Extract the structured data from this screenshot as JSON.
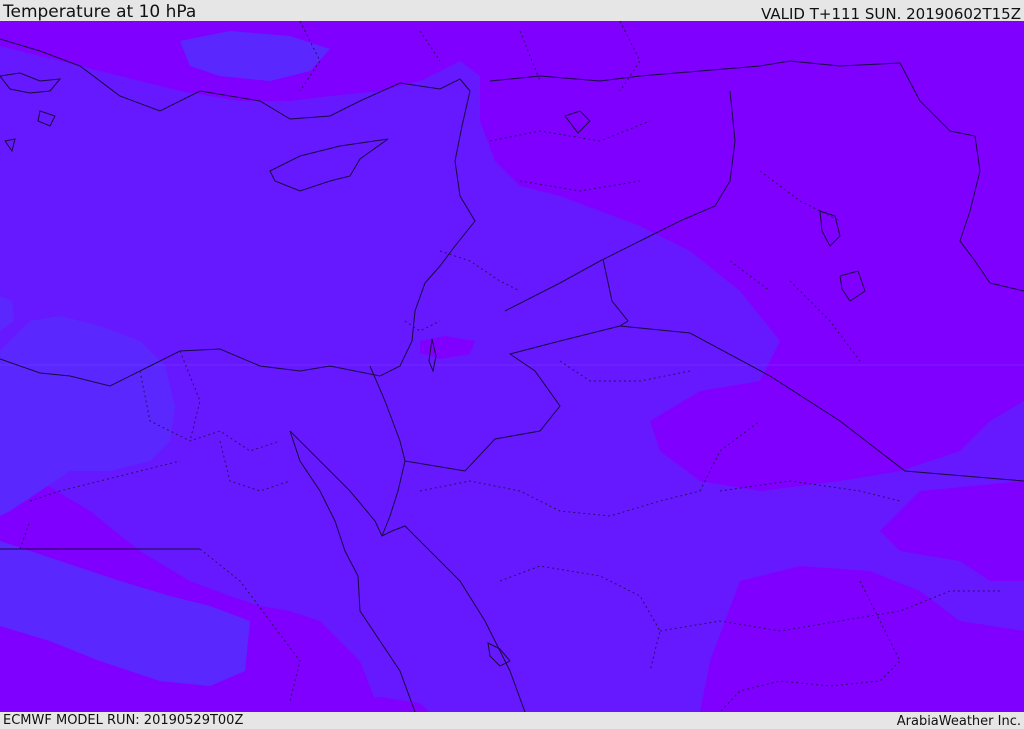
{
  "header": {
    "title": "Temperature at 10 hPa",
    "valid": "VALID T+111 SUN. 20190602T15Z"
  },
  "footer": {
    "model_run": "ECMWF MODEL RUN: 20190529T00Z",
    "credit": "ArabiaWeather Inc."
  },
  "colors": {
    "field_base": "#6619ff",
    "field_warm": "#7f00ff",
    "field_cool": "#5a28ff",
    "coastline": "#1a0a40",
    "border": "#1a0a40",
    "admin_border": "#2a1060",
    "bar_background": "#e6e6e6"
  }
}
